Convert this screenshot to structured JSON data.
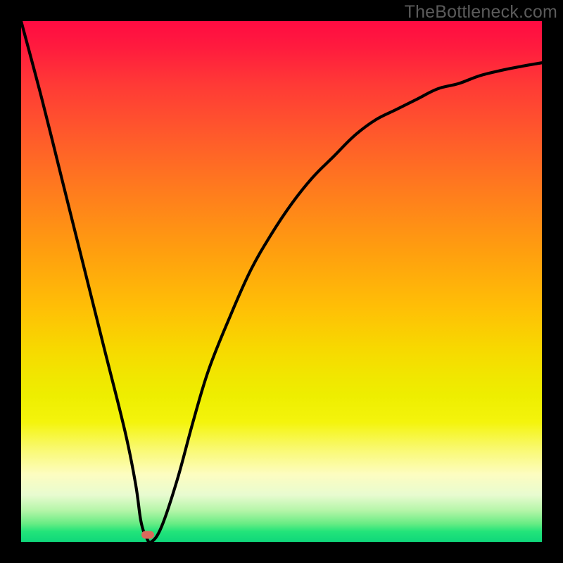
{
  "watermark": "TheBottleneck.com",
  "chart_data": {
    "type": "line",
    "title": "",
    "xlabel": "",
    "ylabel": "",
    "xlim": [
      0,
      100
    ],
    "ylim": [
      0,
      100
    ],
    "grid": false,
    "legend": false,
    "series": [
      {
        "name": "bottleneck-curve",
        "x": [
          0,
          4,
          8,
          12,
          16,
          20,
          22,
          23,
          24,
          25,
          27,
          30,
          33,
          36,
          40,
          44,
          48,
          52,
          56,
          60,
          64,
          68,
          72,
          76,
          80,
          84,
          88,
          92,
          96,
          100
        ],
        "y": [
          100,
          85,
          69,
          53,
          37,
          21,
          11,
          4,
          1,
          0,
          3,
          12,
          23,
          33,
          43,
          52,
          59,
          65,
          70,
          74,
          78,
          81,
          83,
          85,
          87,
          88,
          89.5,
          90.5,
          91.3,
          92
        ]
      }
    ],
    "marker": {
      "x": 24.3,
      "y": 1.3,
      "color": "#d96a5c"
    },
    "background_gradient": {
      "top": "#ff0b42",
      "mid": "#eeee00",
      "bottom": "#0fd77a"
    }
  }
}
